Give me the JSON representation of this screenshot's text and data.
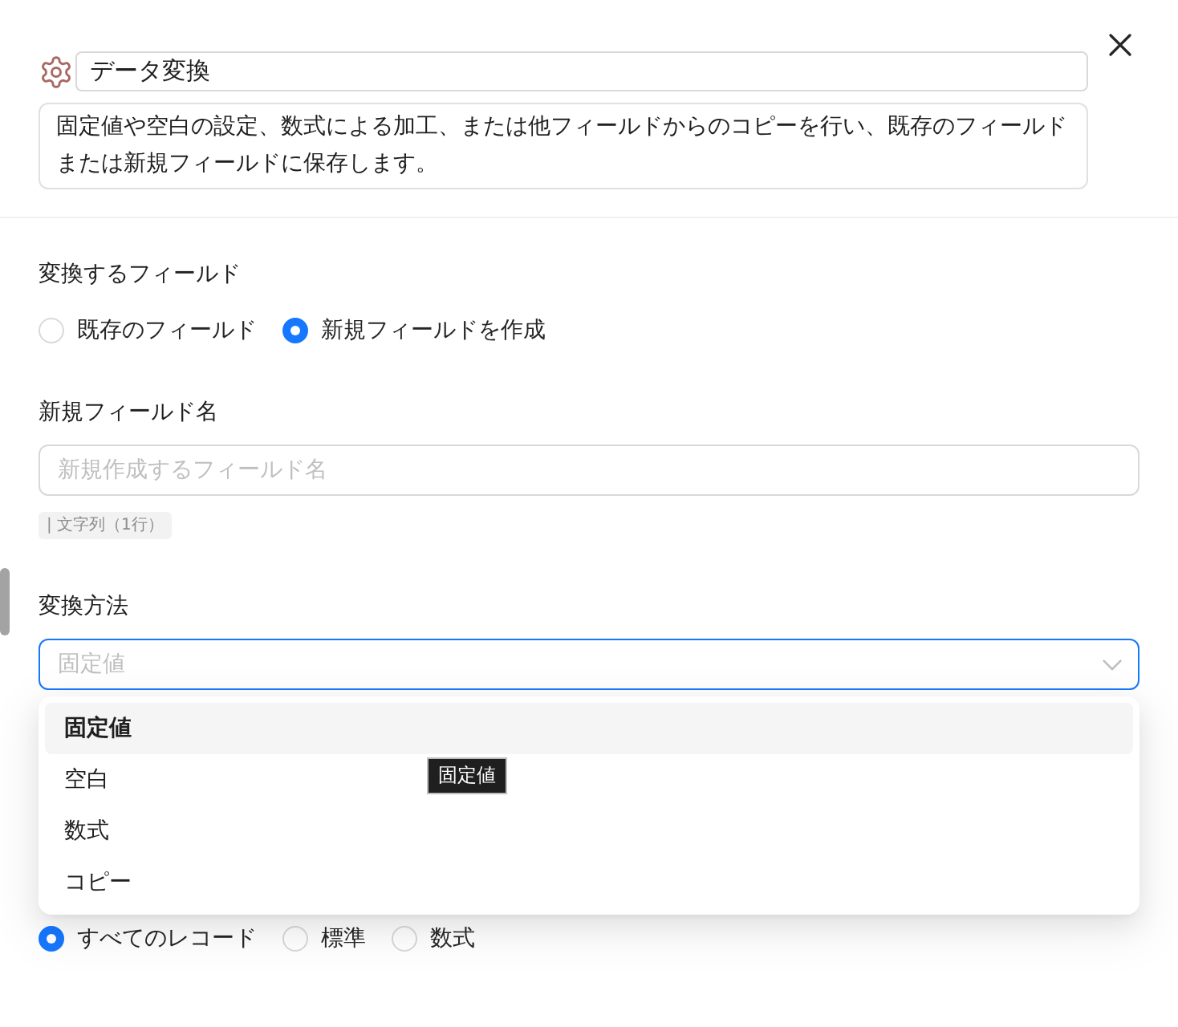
{
  "header": {
    "title": "データ変換",
    "description": "固定値や空白の設定、数式による加工、または他フィールドからのコピーを行い、既存のフィールドまたは新規フィールドに保存します。"
  },
  "target_field": {
    "label": "変換するフィールド",
    "options": [
      {
        "label": "既存のフィールド",
        "selected": false
      },
      {
        "label": "新規フィールドを作成",
        "selected": true
      }
    ]
  },
  "new_field_name": {
    "label": "新規フィールド名",
    "placeholder": "新規作成するフィールド名",
    "type_tag": "| 文字列（1行）"
  },
  "method": {
    "label": "変換方法",
    "placeholder": "固定値",
    "open": true,
    "options": [
      {
        "label": "固定値",
        "selected": true
      },
      {
        "label": "空白",
        "selected": false
      },
      {
        "label": "数式",
        "selected": false
      },
      {
        "label": "コピー",
        "selected": false
      }
    ],
    "tooltip": "固定値"
  },
  "records": {
    "options": [
      {
        "label": "すべてのレコード",
        "selected": true
      },
      {
        "label": "標準",
        "selected": false
      },
      {
        "label": "数式",
        "selected": false
      }
    ]
  }
}
